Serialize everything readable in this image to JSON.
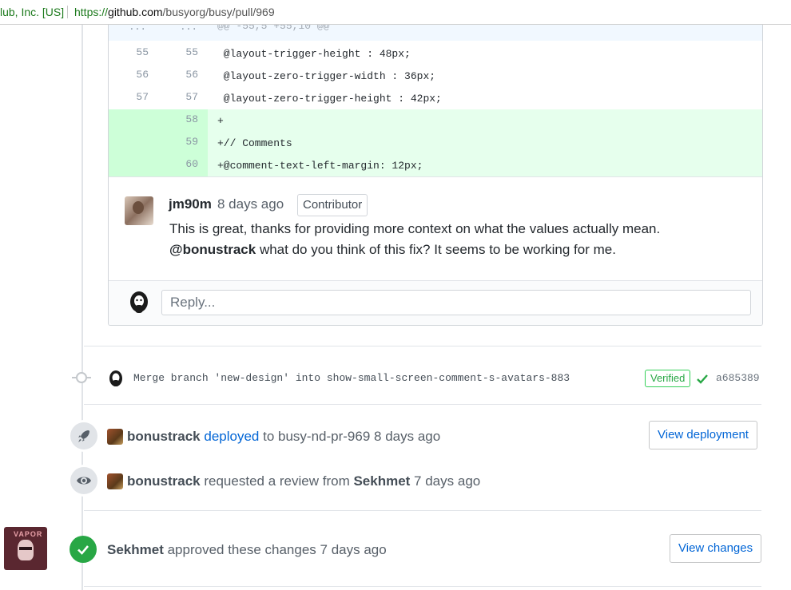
{
  "browser": {
    "org_label": "lub, Inc. [US]",
    "url_proto": "https://",
    "url_host": "github.com",
    "url_path": "/busyorg/busy/pull/969"
  },
  "diff": {
    "hunk": {
      "old": "...",
      "new": "...",
      "text": "@@ -55,5 +55,10 @@"
    },
    "context_lines": [
      {
        "old": "55",
        "new": "55",
        "code": " @layout-trigger-height : 48px;"
      },
      {
        "old": "56",
        "new": "56",
        "code": " @layout-zero-trigger-width : 36px;"
      },
      {
        "old": "57",
        "new": "57",
        "code": " @layout-zero-trigger-height : 42px;"
      }
    ],
    "added_lines": [
      {
        "new": "58",
        "code": "+"
      },
      {
        "new": "59",
        "code": "+// Comments"
      },
      {
        "new": "60",
        "code": "+@comment-text-left-margin: 12px;"
      }
    ]
  },
  "comment": {
    "author": "jm90m",
    "time": "8 days ago",
    "badge": "Contributor",
    "line1": "This is great, thanks for providing more context on what the values actually mean.",
    "mention": "@bonustrack",
    "line2_rest": " what do you think of this fix? It seems to be working for me."
  },
  "reply": {
    "placeholder": "Reply..."
  },
  "commit": {
    "message": "Merge branch 'new-design' into show-small-screen-comment-s-avatars-883",
    "verified": "Verified",
    "sha": "a685389"
  },
  "events": {
    "deploy": {
      "actor": "bonustrack",
      "action": "deployed",
      "rest": " to busy-nd-pr-969 8 days ago",
      "button": "View deployment"
    },
    "review_request": {
      "actor": "bonustrack",
      "action": " requested a review from ",
      "target": "Sekhmet",
      "time": " 7 days ago"
    },
    "approval": {
      "actor": "Sekhmet",
      "action": " approved these changes 7 days ago",
      "button": "View changes",
      "avatar_text": "VAPOR"
    }
  },
  "colors": {
    "added_bg": "#e6ffed",
    "added_num_bg": "#cdffd8",
    "hunk_bg": "#f1f8ff",
    "link": "#0366d6",
    "success": "#28a745"
  }
}
